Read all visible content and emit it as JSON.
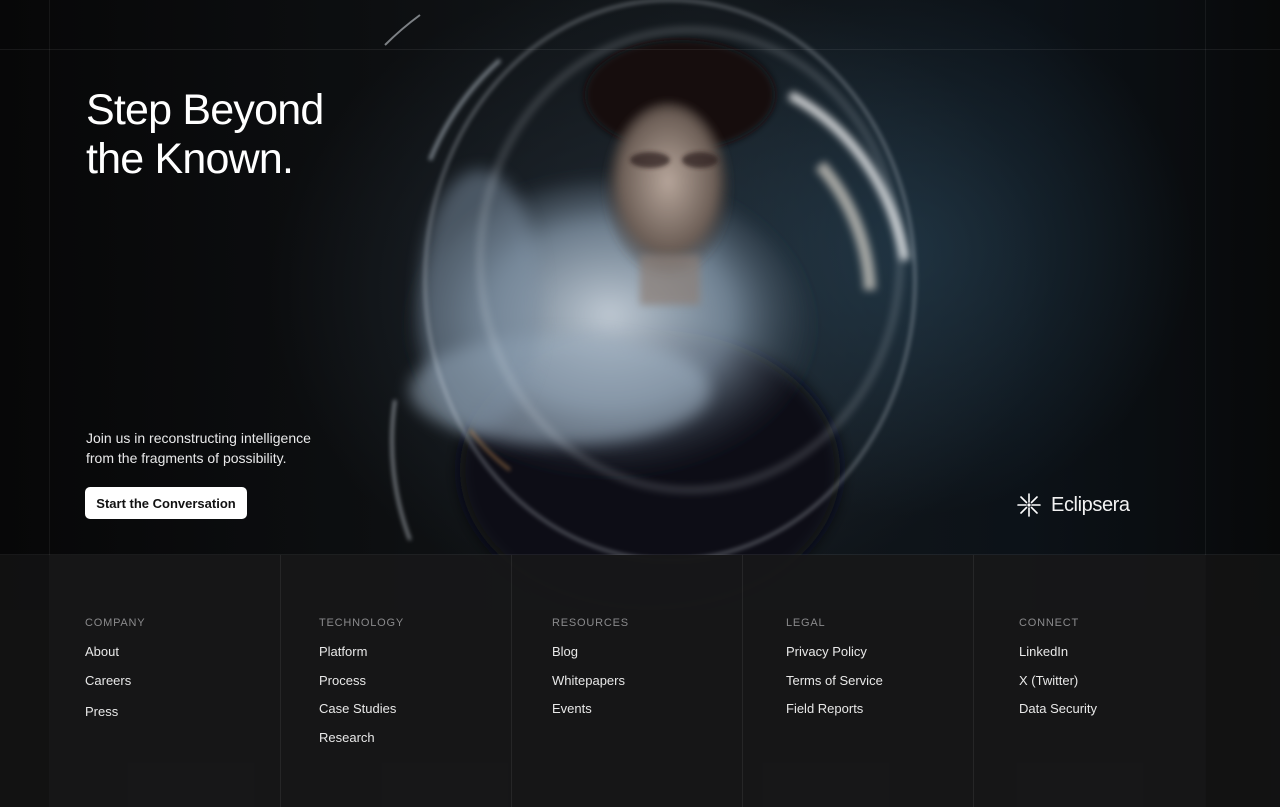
{
  "hero": {
    "headline_line1": "Step Beyond",
    "headline_line2": "the Known.",
    "subcopy_line1": "Join us in reconstructing intelligence",
    "subcopy_line2": "from the fragments of possibility.",
    "cta_label": "Start the Conversation",
    "image_alt": "",
    "accent_color": "#ffffff"
  },
  "brand": {
    "name": "Eclipsera",
    "icon": "asterisk-star-icon"
  },
  "footer": {
    "columns": [
      {
        "title": "COMPANY",
        "links": [
          "About",
          "Careers",
          "Press"
        ]
      },
      {
        "title": "TECHNOLOGY",
        "links": [
          "Platform",
          "Process",
          "Case Studies",
          "Research"
        ]
      },
      {
        "title": "RESOURCES",
        "links": [
          "Blog",
          "Whitepapers",
          "Events"
        ]
      },
      {
        "title": "LEGAL",
        "links": [
          "Privacy Policy",
          "Terms of Service",
          "Field Reports"
        ]
      },
      {
        "title": "CONNECT",
        "links": [
          "LinkedIn",
          "X (Twitter)",
          "Data Security"
        ]
      }
    ]
  }
}
